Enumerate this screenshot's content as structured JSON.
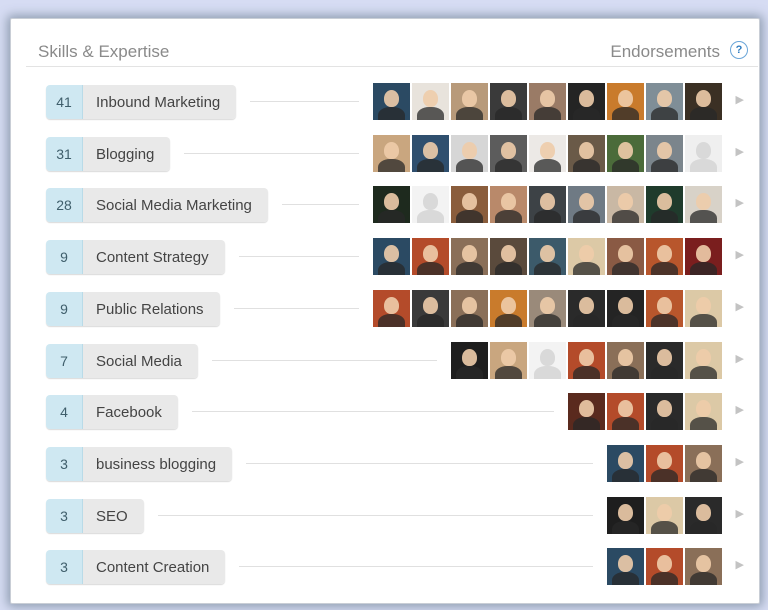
{
  "panel": {
    "title": "Skills & Expertise",
    "endorsements_label": "Endorsements",
    "help_label": "?"
  },
  "skills": [
    {
      "count": "41",
      "label": "Inbound Marketing",
      "avatars": [
        "#2b4a63",
        "#e8e3dc",
        "#b89a7a",
        "#3a3a3a",
        "#9a7b66",
        "#242424",
        "#c97b2c",
        "#7f8e97",
        "#3b3024"
      ]
    },
    {
      "count": "31",
      "label": "Blogging",
      "avatars": [
        "#c9a67f",
        "#2f4f6e",
        "#d6d6d6",
        "#5c5c5c",
        "#ece9e6",
        "#6a5a48",
        "#4b6b3a",
        "#7b858c",
        "#efefef"
      ]
    },
    {
      "count": "28",
      "label": "Social Media Marketing",
      "avatars": [
        "#1e2a1e",
        "#f3f3f3",
        "#8a5d3c",
        "#b9896a",
        "#3d4246",
        "#6f7a84",
        "#c9b8a4",
        "#1f3b2c",
        "#d8d2c8"
      ]
    },
    {
      "count": "9",
      "label": "Content Strategy",
      "avatars": [
        "#2b4a63",
        "#b44b2a",
        "#8a6f58",
        "#5a4a3c",
        "#3c5a6a",
        "#dcc9a6",
        "#8a5a44",
        "#b8562c",
        "#7a1e1e"
      ]
    },
    {
      "count": "9",
      "label": "Public Relations",
      "avatars": [
        "#b44b2a",
        "#3a3a3a",
        "#8a6f58",
        "#c97b2c",
        "#9a8a7a",
        "#2a2a2a",
        "#242424",
        "#b8562c",
        "#dcc9a6"
      ]
    },
    {
      "count": "7",
      "label": "Social Media",
      "avatars": [
        "#1e1e1e",
        "#c9a67f",
        "#f3f3f3",
        "#b44b2a",
        "#8a6f58",
        "#2a2a2a",
        "#dcc9a6"
      ]
    },
    {
      "count": "4",
      "label": "Facebook",
      "avatars": [
        "#5a2a1e",
        "#b44b2a",
        "#2a2a2a",
        "#dcc9a6"
      ]
    },
    {
      "count": "3",
      "label": "business blogging",
      "avatars": [
        "#2b4a63",
        "#b44b2a",
        "#8a6f58"
      ]
    },
    {
      "count": "3",
      "label": "SEO",
      "avatars": [
        "#1e1e1e",
        "#dcc9a6",
        "#2a2a2a"
      ]
    },
    {
      "count": "3",
      "label": "Content Creation",
      "avatars": [
        "#2b4a63",
        "#b44b2a",
        "#8a6f58"
      ]
    }
  ]
}
